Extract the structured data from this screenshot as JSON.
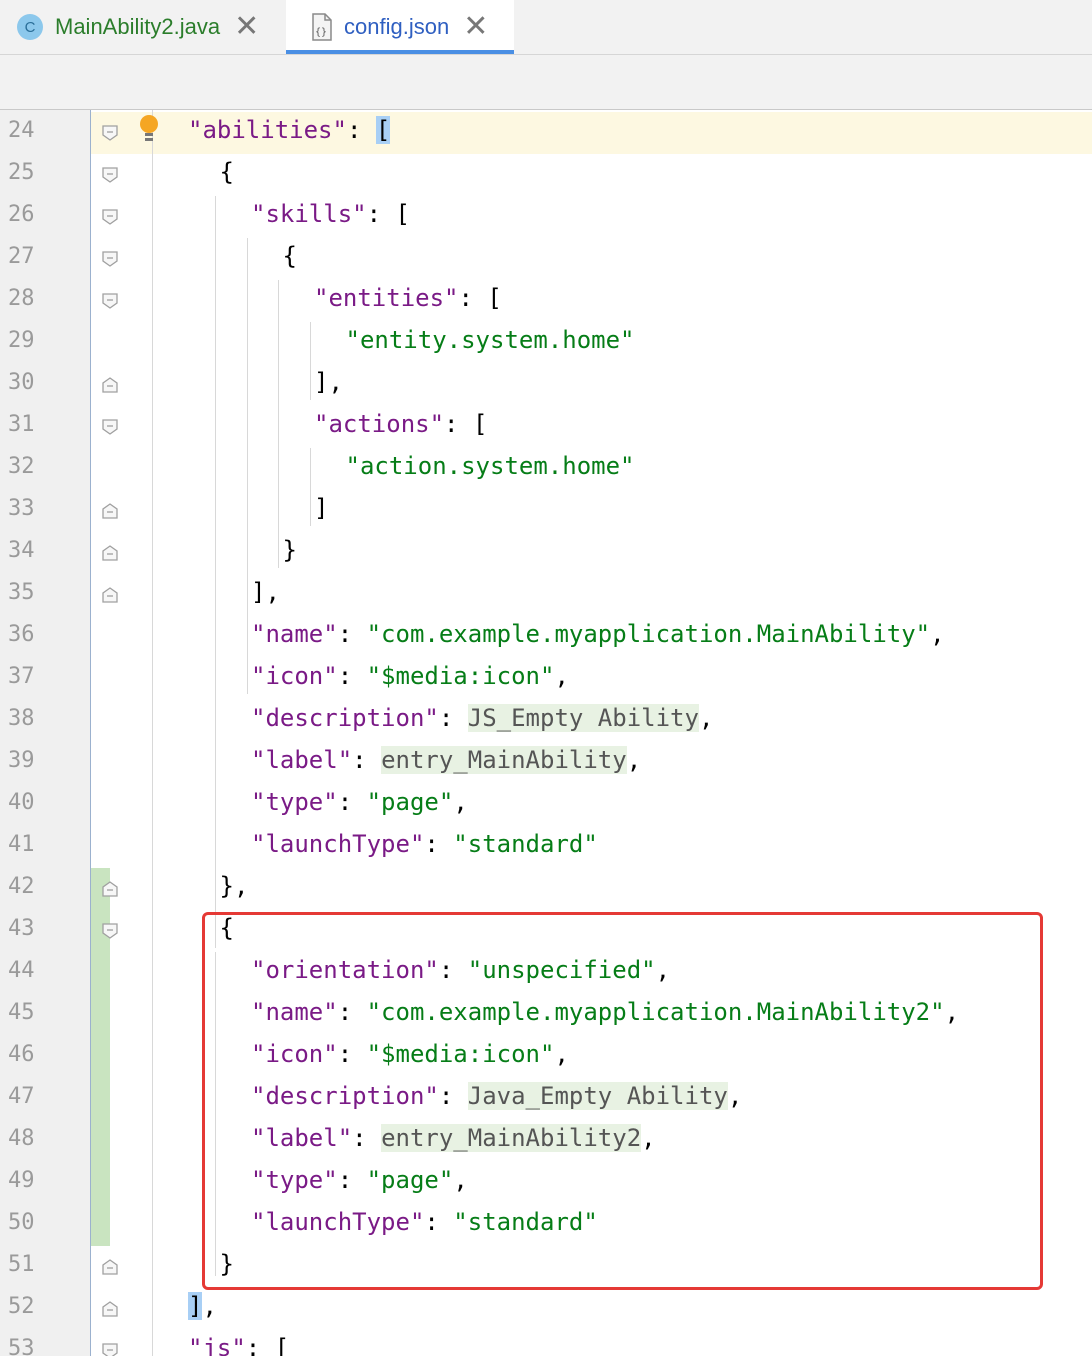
{
  "tabs": [
    {
      "label": "MainAbility2.java",
      "icon": "java-class-icon",
      "icon_letter": "C",
      "active": false
    },
    {
      "label": "config.json",
      "icon": "json-file-icon",
      "active": true
    }
  ],
  "tab_close_glyph": "✕",
  "lines": [
    {
      "n": "24",
      "indent": 0,
      "fold": "open",
      "segs": [
        {
          "t": "\"abilities\"",
          "c": "k"
        },
        {
          "t": ": "
        },
        {
          "t": "[",
          "c": "br"
        }
      ]
    },
    {
      "n": "25",
      "indent": 1,
      "fold": "open",
      "segs": [
        {
          "t": "{"
        }
      ]
    },
    {
      "n": "26",
      "indent": 2,
      "fold": "open",
      "segs": [
        {
          "t": "\"skills\"",
          "c": "k"
        },
        {
          "t": ": ["
        }
      ]
    },
    {
      "n": "27",
      "indent": 3,
      "fold": "open",
      "segs": [
        {
          "t": "{"
        }
      ]
    },
    {
      "n": "28",
      "indent": 4,
      "fold": "open",
      "segs": [
        {
          "t": "\"entities\"",
          "c": "k"
        },
        {
          "t": ": ["
        }
      ]
    },
    {
      "n": "29",
      "indent": 5,
      "fold": "",
      "segs": [
        {
          "t": "\"entity.system.home\"",
          "c": "s"
        }
      ]
    },
    {
      "n": "30",
      "indent": 4,
      "fold": "close",
      "segs": [
        {
          "t": "],"
        }
      ]
    },
    {
      "n": "31",
      "indent": 4,
      "fold": "open",
      "segs": [
        {
          "t": "\"actions\"",
          "c": "k"
        },
        {
          "t": ": ["
        }
      ]
    },
    {
      "n": "32",
      "indent": 5,
      "fold": "",
      "segs": [
        {
          "t": "\"action.system.home\"",
          "c": "s"
        }
      ]
    },
    {
      "n": "33",
      "indent": 4,
      "fold": "close",
      "segs": [
        {
          "t": "]"
        }
      ]
    },
    {
      "n": "34",
      "indent": 3,
      "fold": "close",
      "segs": [
        {
          "t": "}"
        }
      ]
    },
    {
      "n": "35",
      "indent": 2,
      "fold": "close",
      "segs": [
        {
          "t": "],"
        }
      ]
    },
    {
      "n": "36",
      "indent": 2,
      "fold": "",
      "segs": [
        {
          "t": "\"name\"",
          "c": "k"
        },
        {
          "t": ": "
        },
        {
          "t": "\"com.example.myapplication.MainAbility\"",
          "c": "s"
        },
        {
          "t": ","
        }
      ]
    },
    {
      "n": "37",
      "indent": 2,
      "fold": "",
      "segs": [
        {
          "t": "\"icon\"",
          "c": "k"
        },
        {
          "t": ": "
        },
        {
          "t": "\"$media:icon\"",
          "c": "s"
        },
        {
          "t": ","
        }
      ]
    },
    {
      "n": "38",
      "indent": 2,
      "fold": "",
      "segs": [
        {
          "t": "\"description\"",
          "c": "k"
        },
        {
          "t": ": "
        },
        {
          "t": "JS_Empty Ability",
          "c": "ph"
        },
        {
          "t": ","
        }
      ]
    },
    {
      "n": "39",
      "indent": 2,
      "fold": "",
      "segs": [
        {
          "t": "\"label\"",
          "c": "k"
        },
        {
          "t": ": "
        },
        {
          "t": "entry_MainAbility",
          "c": "ph"
        },
        {
          "t": ","
        }
      ]
    },
    {
      "n": "40",
      "indent": 2,
      "fold": "",
      "segs": [
        {
          "t": "\"type\"",
          "c": "k"
        },
        {
          "t": ": "
        },
        {
          "t": "\"page\"",
          "c": "s"
        },
        {
          "t": ","
        }
      ]
    },
    {
      "n": "41",
      "indent": 2,
      "fold": "",
      "segs": [
        {
          "t": "\"launchType\"",
          "c": "k"
        },
        {
          "t": ": "
        },
        {
          "t": "\"standard\"",
          "c": "s"
        }
      ]
    },
    {
      "n": "42",
      "indent": 1,
      "fold": "close",
      "segs": [
        {
          "t": "},"
        }
      ]
    },
    {
      "n": "43",
      "indent": 1,
      "fold": "open",
      "segs": [
        {
          "t": "{"
        }
      ]
    },
    {
      "n": "44",
      "indent": 2,
      "fold": "",
      "segs": [
        {
          "t": "\"orientation\"",
          "c": "k"
        },
        {
          "t": ": "
        },
        {
          "t": "\"unspecified\"",
          "c": "s"
        },
        {
          "t": ","
        }
      ]
    },
    {
      "n": "45",
      "indent": 2,
      "fold": "",
      "segs": [
        {
          "t": "\"name\"",
          "c": "k"
        },
        {
          "t": ": "
        },
        {
          "t": "\"com.example.myapplication.MainAbility2\"",
          "c": "s"
        },
        {
          "t": ","
        }
      ]
    },
    {
      "n": "46",
      "indent": 2,
      "fold": "",
      "segs": [
        {
          "t": "\"icon\"",
          "c": "k"
        },
        {
          "t": ": "
        },
        {
          "t": "\"$media:icon\"",
          "c": "s"
        },
        {
          "t": ","
        }
      ]
    },
    {
      "n": "47",
      "indent": 2,
      "fold": "",
      "segs": [
        {
          "t": "\"description\"",
          "c": "k"
        },
        {
          "t": ": "
        },
        {
          "t": "Java_Empty Ability",
          "c": "ph"
        },
        {
          "t": ","
        }
      ]
    },
    {
      "n": "48",
      "indent": 2,
      "fold": "",
      "segs": [
        {
          "t": "\"label\"",
          "c": "k"
        },
        {
          "t": ": "
        },
        {
          "t": "entry_MainAbility2",
          "c": "ph"
        },
        {
          "t": ","
        }
      ]
    },
    {
      "n": "49",
      "indent": 2,
      "fold": "",
      "segs": [
        {
          "t": "\"type\"",
          "c": "k"
        },
        {
          "t": ": "
        },
        {
          "t": "\"page\"",
          "c": "s"
        },
        {
          "t": ","
        }
      ]
    },
    {
      "n": "50",
      "indent": 2,
      "fold": "",
      "segs": [
        {
          "t": "\"launchType\"",
          "c": "k"
        },
        {
          "t": ": "
        },
        {
          "t": "\"standard\"",
          "c": "s"
        }
      ]
    },
    {
      "n": "51",
      "indent": 1,
      "fold": "close",
      "segs": [
        {
          "t": "}"
        }
      ]
    },
    {
      "n": "52",
      "indent": 0,
      "fold": "close",
      "segs": [
        {
          "t": "]",
          "c": "br"
        },
        {
          "t": ","
        }
      ]
    },
    {
      "n": "53",
      "indent": 0,
      "fold": "open",
      "segs": [
        {
          "t": "\"js\"",
          "c": "k"
        },
        {
          "t": ": ["
        }
      ]
    }
  ],
  "colors": {
    "key": "#7a1a86",
    "string": "#067d17",
    "placeholder_bg": "#e8f2e3",
    "bracket_match": "#a8cff5",
    "current_line": "#fdf8e1",
    "highlight_box": "#e53935",
    "vcs_added": "#c9e4c0"
  }
}
